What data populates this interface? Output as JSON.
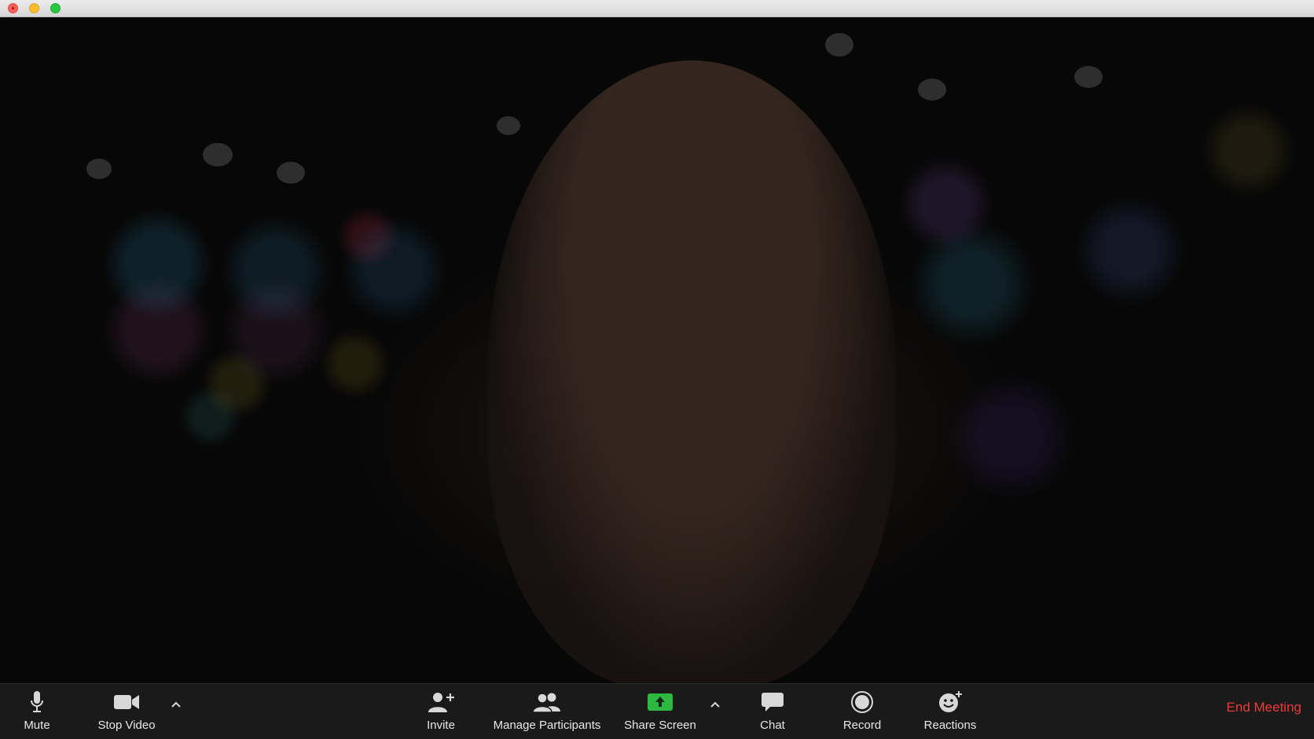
{
  "window": {
    "controls": [
      "close",
      "minimize",
      "maximize"
    ]
  },
  "toolbar": {
    "mute_label": "Mute",
    "stop_video_label": "Stop Video",
    "invite_label": "Invite",
    "manage_participants_label": "Manage Participants",
    "share_screen_label": "Share Screen",
    "chat_label": "Chat",
    "record_label": "Record",
    "reactions_label": "Reactions",
    "end_meeting_label": "End Meeting"
  },
  "icons": {
    "mute": "microphone-icon",
    "stop_video": "video-camera-icon",
    "invite": "add-person-icon",
    "participants": "participants-icon",
    "share": "share-screen-icon",
    "chat": "chat-bubble-icon",
    "record": "record-icon",
    "reactions": "smiley-add-icon"
  },
  "colors": {
    "toolbar_bg": "#1a1a1a",
    "label": "#e8e8e8",
    "icon": "#d8d8d8",
    "share_green": "#2db842",
    "end_meeting": "#ec3b36"
  }
}
